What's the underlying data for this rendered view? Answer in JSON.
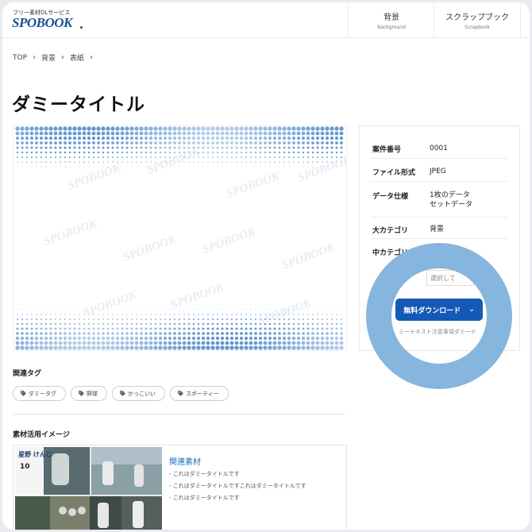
{
  "header": {
    "tagline": "フリー素材DLサービス",
    "logo": "SPOBOOK",
    "nav": [
      {
        "label": "背景",
        "sub": "Background"
      },
      {
        "label": "スクラップブック",
        "sub": "Scrapbook"
      }
    ]
  },
  "breadcrumb": [
    "TOP",
    "背景",
    "表紙"
  ],
  "page_title": "ダミータイトル",
  "hero": {
    "watermark": "SPOBOOK",
    "gradient_color": "#4a86c8"
  },
  "info": {
    "rows": [
      {
        "key": "案件番号",
        "value": "0001"
      },
      {
        "key": "ファイル形式",
        "value": "JPEG"
      },
      {
        "key": "データ仕様",
        "value_line1": "1枚のデータ",
        "value_line2": "セットデータ"
      },
      {
        "key": "大カテゴリ",
        "value": "背景"
      },
      {
        "key": "中カテゴリ"
      }
    ],
    "select_placeholder": "選択して",
    "download_label": "無料ダウンロード",
    "note": "ミーテキスト注意事項ダミーテ"
  },
  "spotlight_color": "#86b6de",
  "accent": "#1459b5",
  "tags_section": {
    "title": "関連タグ",
    "tags": [
      "ダミータグ",
      "野球",
      "かっこいい",
      "スポーティー"
    ]
  },
  "usage_section": {
    "title": "素材活用イメージ",
    "thumb": {
      "name": "星野 けんじ",
      "number": "10"
    },
    "related_title": "関連素材",
    "related_items": [
      "- これはダミータイトルです",
      "- これはダミータイトルですこれはダミータイトルです",
      "- これはダミータイトルです"
    ]
  }
}
